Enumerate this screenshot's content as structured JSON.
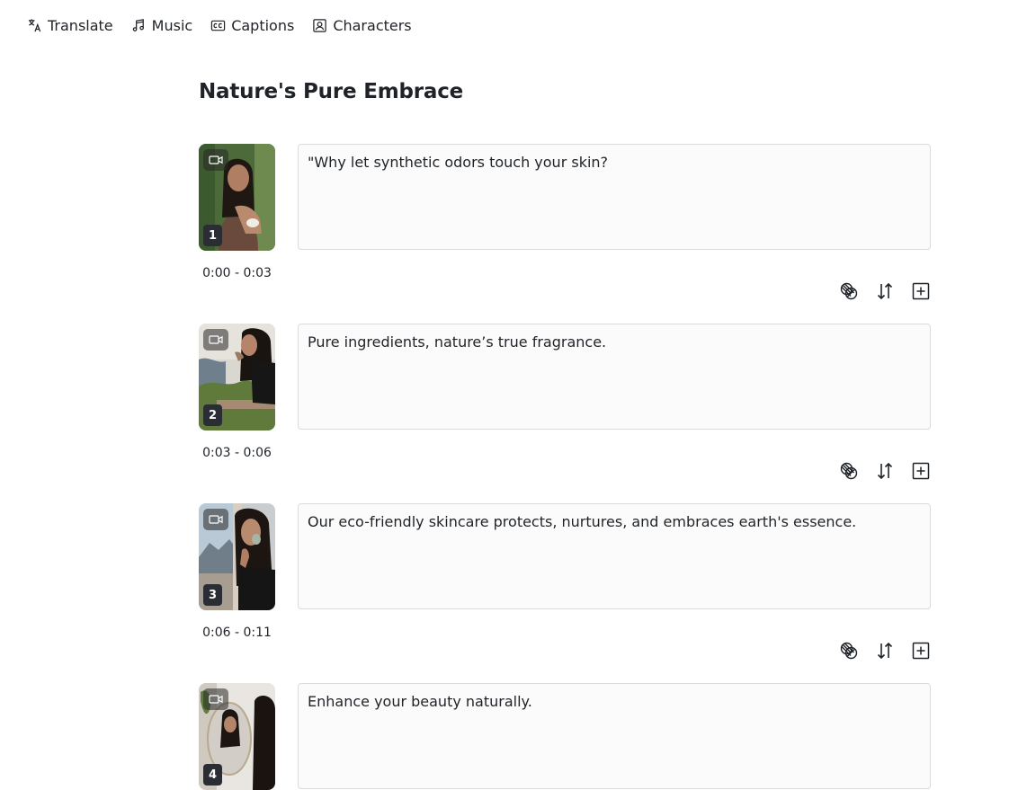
{
  "topbar": {
    "items": [
      {
        "label": "Translate",
        "icon": "translate-icon"
      },
      {
        "label": "Music",
        "icon": "music-note-icon"
      },
      {
        "label": "Captions",
        "icon": "captions-icon"
      },
      {
        "label": "Characters",
        "icon": "character-portrait-icon"
      }
    ]
  },
  "project": {
    "title": "Nature's Pure Embrace"
  },
  "scenes": [
    {
      "number": "1",
      "time": "0:00 - 0:03",
      "caption": "\"Why let synthetic odors touch your skin?"
    },
    {
      "number": "2",
      "time": "0:03 - 0:06",
      "caption": "Pure ingredients, nature’s true fragrance."
    },
    {
      "number": "3",
      "time": "0:06 - 0:11",
      "caption": "Our eco-friendly skincare protects, nurtures, and embraces earth's essence."
    },
    {
      "number": "4",
      "time": "",
      "caption": "Enhance your beauty naturally."
    }
  ],
  "scene_actions": [
    "voice-style-icon",
    "reorder-icon",
    "add-scene-icon"
  ]
}
